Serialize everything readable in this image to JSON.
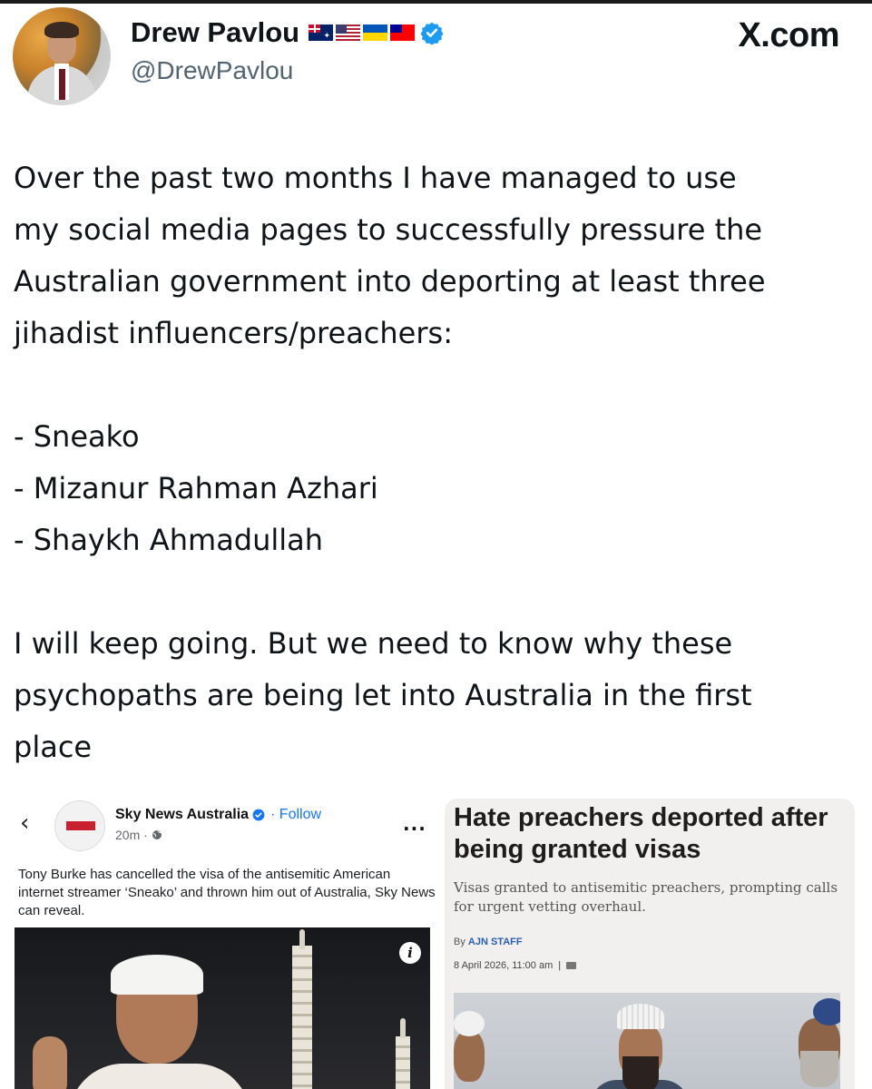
{
  "tweet": {
    "author": {
      "display_name": "Drew Pavlou",
      "handle": "@DrewPavlou",
      "flags": [
        "australia-flag",
        "usa-flag",
        "ukraine-flag",
        "taiwan-flag"
      ],
      "verified": true
    },
    "brand": "X.com",
    "text_lines": {
      "p1_l1": "Over the past two months I have managed to use",
      "p1_l2": "my social media pages to successfully pressure the",
      "p1_l3": "Australian government into deporting at least three",
      "p1_l4": "jihadist influencers/preachers:",
      "list1": "- Sneako",
      "list2": "- Mizanur Rahman Azhari",
      "list3": "- Shaykh Ahmadullah",
      "p3_l1": "I will keep going. But we need to know why these",
      "p3_l2": "psychopaths are being let into Australia in the first",
      "p3_l3": "place"
    }
  },
  "left_card": {
    "back_icon": "‹",
    "source_name": "Sky News Australia",
    "follow_label": "· Follow",
    "time": "20m ·",
    "more_label": "...",
    "description": "Tony Burke has cancelled the visa of the antisemitic American internet streamer ‘Sneako’ and thrown him out of Australia, Sky News can reveal.",
    "info_label": "i"
  },
  "right_card": {
    "headline": "Hate preachers deported after being granted visas",
    "subhead": "Visas granted to antisemitic preachers, prompting calls for urgent vetting overhaul.",
    "byline_prefix": "By",
    "byline_author": "AJN STAFF",
    "date": "8 April 2026, 11:00 am",
    "date_sep": "|"
  },
  "colors": {
    "text": "#0f1419",
    "secondary": "#536471",
    "verified_blue": "#1d9bf0",
    "facebook_blue": "#1877f2"
  }
}
